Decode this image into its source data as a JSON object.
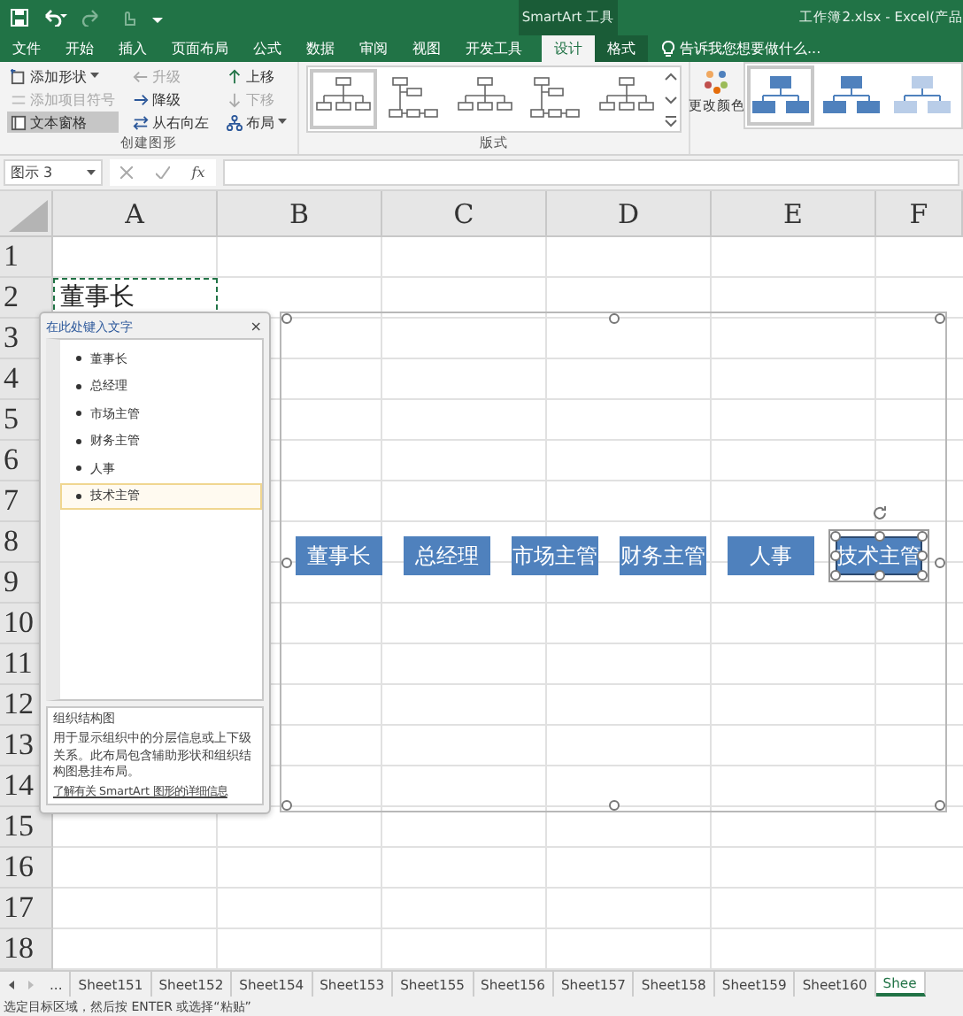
{
  "title_bar": {
    "title": "工作簿2.xlsx - Excel(产品",
    "context_tool": "SmartArt 工具"
  },
  "tabs": [
    {
      "label": "文件",
      "selected": false
    },
    {
      "label": "开始",
      "selected": false
    },
    {
      "label": "插入",
      "selected": false
    },
    {
      "label": "页面布局",
      "selected": false
    },
    {
      "label": "公式",
      "selected": false
    },
    {
      "label": "数据",
      "selected": false
    },
    {
      "label": "审阅",
      "selected": false
    },
    {
      "label": "视图",
      "selected": false
    },
    {
      "label": "开发工具",
      "selected": false
    },
    {
      "label": "设计",
      "selected": true
    },
    {
      "label": "格式",
      "selected": false
    }
  ],
  "tell_me": "告诉我您想要做什么...",
  "ribbon": {
    "create_group": {
      "label": "创建图形",
      "columns": [
        [
          {
            "label": "添加形状",
            "kind": "add",
            "disabled": false,
            "dropdown": true,
            "selected": false
          },
          {
            "label": "添加项目符号",
            "kind": "bullet",
            "disabled": true,
            "dropdown": false,
            "selected": false
          },
          {
            "label": "文本窗格",
            "kind": "pane",
            "disabled": false,
            "dropdown": false,
            "selected": true
          }
        ],
        [
          {
            "label": "升级",
            "kind": "left",
            "disabled": true,
            "dropdown": false,
            "selected": false
          },
          {
            "label": "降级",
            "kind": "right",
            "disabled": false,
            "dropdown": false,
            "selected": false
          },
          {
            "label": "从右向左",
            "kind": "swap",
            "disabled": false,
            "dropdown": false,
            "selected": false
          }
        ],
        [
          {
            "label": "上移",
            "kind": "up",
            "disabled": false,
            "dropdown": false,
            "selected": false
          },
          {
            "label": "下移",
            "kind": "down",
            "disabled": true,
            "dropdown": false,
            "selected": false
          },
          {
            "label": "布局",
            "kind": "tree",
            "disabled": false,
            "dropdown": true,
            "selected": false
          }
        ]
      ]
    },
    "layouts_label": "版式",
    "change_colors": "更改颜色"
  },
  "name_box": "图示 3",
  "fx": "fx",
  "columns": [
    "A",
    "B",
    "C",
    "D",
    "E",
    "F"
  ],
  "rows": [
    {
      "label": "1"
    },
    {
      "label": "2",
      "cells": [
        "董事长"
      ]
    },
    {
      "label": "3"
    },
    {
      "label": "4"
    },
    {
      "label": "5"
    },
    {
      "label": "6"
    },
    {
      "label": "7"
    },
    {
      "label": "8"
    },
    {
      "label": "9"
    },
    {
      "label": "10"
    },
    {
      "label": "11"
    },
    {
      "label": "12"
    },
    {
      "label": "13"
    },
    {
      "label": "14"
    },
    {
      "label": "15"
    },
    {
      "label": "16"
    },
    {
      "label": "17"
    },
    {
      "label": "18"
    }
  ],
  "text_pane": {
    "title": "在此处键入文字",
    "close": "×",
    "items": [
      {
        "text": "董事长",
        "selected": false
      },
      {
        "text": "总经理",
        "selected": false
      },
      {
        "text": "市场主管",
        "selected": false
      },
      {
        "text": "财务主管",
        "selected": false
      },
      {
        "text": "人事",
        "selected": false
      },
      {
        "text": "技术主管",
        "selected": true
      }
    ],
    "description_title": "组织结构图",
    "description": "用于显示组织中的分层信息或上下级关系。此布局包含辅助形状和组织结构图悬挂布局。",
    "link": "了解有关 SmartArt 图形的详细信息"
  },
  "smartart_nodes": [
    {
      "text": "董事长",
      "selected": false
    },
    {
      "text": "总经理",
      "selected": false
    },
    {
      "text": "市场主管",
      "selected": false
    },
    {
      "text": "财务主管",
      "selected": false
    },
    {
      "text": "人事",
      "selected": false
    },
    {
      "text": "技术主管",
      "selected": true
    }
  ],
  "sheet_tabs": [
    {
      "label": "...",
      "selected": false
    },
    {
      "label": "Sheet151",
      "selected": false
    },
    {
      "label": "Sheet152",
      "selected": false
    },
    {
      "label": "Sheet154",
      "selected": false
    },
    {
      "label": "Sheet153",
      "selected": false
    },
    {
      "label": "Sheet155",
      "selected": false
    },
    {
      "label": "Sheet156",
      "selected": false
    },
    {
      "label": "Sheet157",
      "selected": false
    },
    {
      "label": "Sheet158",
      "selected": false
    },
    {
      "label": "Sheet159",
      "selected": false
    },
    {
      "label": "Sheet160",
      "selected": false
    },
    {
      "label": "Shee",
      "selected": true
    }
  ],
  "status": "选定目标区域，然后按 ENTER 或选择“粘贴”"
}
